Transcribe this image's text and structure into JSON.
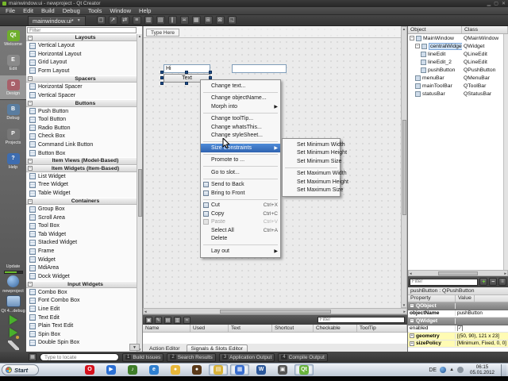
{
  "window": {
    "title": "mainwindow.ui - newproject - Qt Creator"
  },
  "menubar": {
    "items": [
      "File",
      "Edit",
      "Build",
      "Debug",
      "Tools",
      "Window",
      "Help"
    ]
  },
  "designer_toolbar": {
    "doc_tab": "mainwindow.ui*",
    "icons": [
      "edit-widgets",
      "edit-signals-slots",
      "edit-buddies",
      "edit-tab-order",
      "layout-horizontally",
      "layout-vertically",
      "layout-splitter-horizontal",
      "layout-splitter-vertical",
      "layout-form",
      "layout-grid",
      "break-layout",
      "adjust-size"
    ]
  },
  "mode_rail": {
    "modes": [
      {
        "label": "Welcome",
        "glyph": "Qt",
        "color": "#6faf2c",
        "active": false
      },
      {
        "label": "Edit",
        "glyph": "E",
        "color": "#8a8a8a",
        "active": false
      },
      {
        "label": "Design",
        "glyph": "D",
        "color": "#a8606a",
        "active": true
      },
      {
        "label": "Debug",
        "glyph": "B",
        "color": "#5a7da0",
        "active": false
      },
      {
        "label": "Projects",
        "glyph": "P",
        "color": "#777777",
        "active": false
      },
      {
        "label": "Help",
        "glyph": "?",
        "color": "#3e6db0",
        "active": false
      }
    ],
    "update_label": "Update",
    "project_label": "newproject",
    "target_label": "Qt 4...debug"
  },
  "widget_box": {
    "filter_placeholder": "Filter",
    "sections": [
      {
        "title": "Layouts",
        "items": [
          "Vertical Layout",
          "Horizontal Layout",
          "Grid Layout",
          "Form Layout"
        ]
      },
      {
        "title": "Spacers",
        "items": [
          "Horizontal Spacer",
          "Vertical Spacer"
        ]
      },
      {
        "title": "Buttons",
        "items": [
          "Push Button",
          "Tool Button",
          "Radio Button",
          "Check Box",
          "Command Link Button",
          "Button Box"
        ]
      },
      {
        "title": "Item Views (Model-Based)",
        "items": []
      },
      {
        "title": "Item Widgets (Item-Based)",
        "items": [
          "List Widget",
          "Tree Widget",
          "Table Widget"
        ]
      },
      {
        "title": "Containers",
        "items": [
          "Group Box",
          "Scroll Area",
          "Tool Box",
          "Tab Widget",
          "Stacked Widget",
          "Frame",
          "Widget",
          "MdiArea",
          "Dock Widget"
        ]
      },
      {
        "title": "Input Widgets",
        "items": [
          "Combo Box",
          "Font Combo Box",
          "Line Edit",
          "Text Edit",
          "Plain Text Edit",
          "Spin Box",
          "Double Spin Box"
        ]
      }
    ]
  },
  "form": {
    "menu_placeholder": "Type Here",
    "line_edit_1": "Hi",
    "line_edit_2": "",
    "push_button_text": "Text"
  },
  "context_menu": {
    "items": [
      {
        "label": "Change text..."
      },
      {
        "type": "sep"
      },
      {
        "label": "Change objectName..."
      },
      {
        "label": "Morph into",
        "submenu": true
      },
      {
        "type": "sep"
      },
      {
        "label": "Change toolTip..."
      },
      {
        "label": "Change whatsThis..."
      },
      {
        "label": "Change styleSheet..."
      },
      {
        "type": "sep"
      },
      {
        "label": "Size Constraints",
        "submenu": true,
        "selected": true
      },
      {
        "type": "sep"
      },
      {
        "label": "Promote to ..."
      },
      {
        "type": "sep"
      },
      {
        "label": "Go to slot..."
      },
      {
        "type": "sep"
      },
      {
        "label": "Send to Back",
        "icon": "send-to-back"
      },
      {
        "label": "Bring to Front",
        "icon": "bring-to-front"
      },
      {
        "type": "sep"
      },
      {
        "label": "Cut",
        "shortcut": "Ctrl+X",
        "icon": "cut"
      },
      {
        "label": "Copy",
        "shortcut": "Ctrl+C",
        "icon": "copy"
      },
      {
        "label": "Paste",
        "shortcut": "Ctrl+V",
        "icon": "paste",
        "disabled": true
      },
      {
        "label": "Select All",
        "shortcut": "Ctrl+A"
      },
      {
        "label": "Delete"
      },
      {
        "type": "sep"
      },
      {
        "label": "Lay out",
        "submenu": true
      }
    ]
  },
  "submenu": {
    "items": [
      {
        "label": "Set Minimum Width"
      },
      {
        "label": "Set Minimum Height"
      },
      {
        "label": "Set Minimum Size"
      },
      {
        "type": "sep"
      },
      {
        "label": "Set Maximum Width"
      },
      {
        "label": "Set Maximum Height"
      },
      {
        "label": "Set Maximum Size"
      }
    ]
  },
  "object_inspector": {
    "columns": [
      "Object",
      "Class"
    ],
    "rows": [
      {
        "object": "MainWindow",
        "class": "QMainWindow",
        "depth": 0,
        "expander": true
      },
      {
        "object": "centralWidget",
        "class": "QWidget",
        "depth": 1,
        "expander": true,
        "selected": true
      },
      {
        "object": "lineEdit",
        "class": "QLineEdit",
        "depth": 2
      },
      {
        "object": "lineEdit_2",
        "class": "QLineEdit",
        "depth": 2
      },
      {
        "object": "pushButton",
        "class": "QPushButton",
        "depth": 2
      },
      {
        "object": "menuBar",
        "class": "QMenuBar",
        "depth": 1
      },
      {
        "object": "mainToolBar",
        "class": "QToolBar",
        "depth": 1
      },
      {
        "object": "statusBar",
        "class": "QStatusBar",
        "depth": 1
      }
    ]
  },
  "property_editor": {
    "filter_placeholder": "Filter",
    "title": "pushButton : QPushButton",
    "columns": [
      "Property",
      "Value"
    ],
    "rows": [
      {
        "type": "group",
        "name": "QObject"
      },
      {
        "type": "prop",
        "name": "objectName",
        "value": "pushButton",
        "bold": true
      },
      {
        "type": "group",
        "name": "QWidget"
      },
      {
        "type": "prop",
        "name": "enabled",
        "value": "",
        "checkbox": true
      },
      {
        "type": "prop",
        "name": "geometry",
        "value": "[(50, 90), 121 x 23]",
        "bold": true,
        "yellow": true,
        "expander": true
      },
      {
        "type": "prop",
        "name": "sizePolicy",
        "value": "[Minimum, Fixed, 0, 0]",
        "bold": true,
        "yellow": true,
        "expander": true
      }
    ]
  },
  "action_editor": {
    "filter_placeholder": "Filter",
    "toolbar_icons": [
      "new-action",
      "edit-action",
      "copy-action",
      "delete-action",
      "configure-action"
    ],
    "columns": [
      "Name",
      "Used",
      "Text",
      "Shortcut",
      "Checkable",
      "ToolTip"
    ],
    "tabs": [
      "Action Editor",
      "Signals & Slots Editor"
    ]
  },
  "locator": {
    "placeholder": "Type to locate",
    "panes": [
      {
        "num": "1",
        "label": "Build Issues"
      },
      {
        "num": "2",
        "label": "Search Results"
      },
      {
        "num": "3",
        "label": "Application Output"
      },
      {
        "num": "4",
        "label": "Compile Output"
      }
    ]
  },
  "taskbar": {
    "start_label": "Start",
    "icons": [
      {
        "name": "opera",
        "color": "#d6101c",
        "glyph": "O",
        "pressed": false
      },
      {
        "name": "media-player",
        "color": "#2b6fd4",
        "glyph": "▶",
        "pressed": false
      },
      {
        "name": "winamp",
        "color": "#3f7d2a",
        "glyph": "♪",
        "pressed": false
      },
      {
        "name": "internet-explorer",
        "color": "#2f7fd0",
        "glyph": "e",
        "pressed": false
      },
      {
        "name": "chrome",
        "color": "#e8b73a",
        "glyph": "●",
        "pressed": false
      },
      {
        "name": "browser-sphere",
        "color": "#5a3a1a",
        "glyph": "●",
        "pressed": false
      },
      {
        "name": "explorer-folder",
        "color": "#d8b23a",
        "glyph": "▤",
        "pressed": true
      },
      {
        "name": "display-settings",
        "color": "#3a6fd0",
        "glyph": "▦",
        "pressed": true
      },
      {
        "name": "word",
        "color": "#2b579a",
        "glyph": "W",
        "pressed": false
      },
      {
        "name": "presentation",
        "color": "#555555",
        "glyph": "▣",
        "pressed": false
      },
      {
        "name": "qt-creator",
        "color": "#69b33e",
        "glyph": "Qt",
        "pressed": true
      }
    ],
    "tray": {
      "lang": "DE",
      "time": "06:15",
      "date": "05.01.2012"
    }
  }
}
